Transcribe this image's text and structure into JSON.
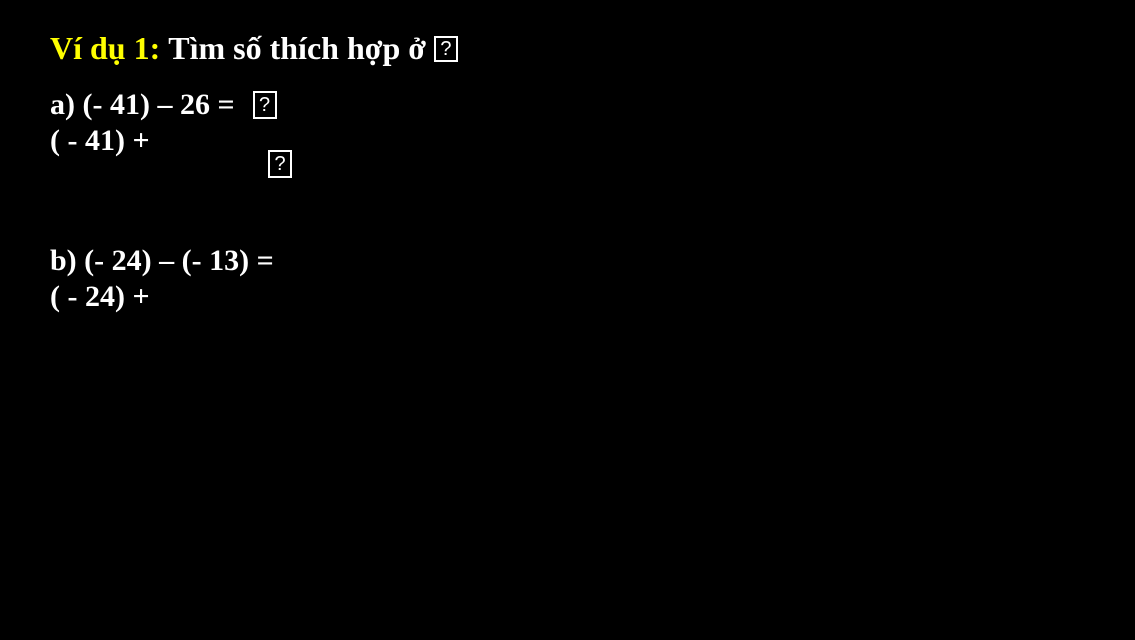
{
  "title": {
    "prefix": "Ví dụ 1:",
    "text": "Tìm số thích hợp ở"
  },
  "qmark": "?",
  "problem_a": {
    "line1": "a) (- 41) – 26 =",
    "line2": "( - 41) +"
  },
  "problem_b": {
    "line1": "b) (- 24) – (- 13) =",
    "line2": "( - 24) +"
  }
}
